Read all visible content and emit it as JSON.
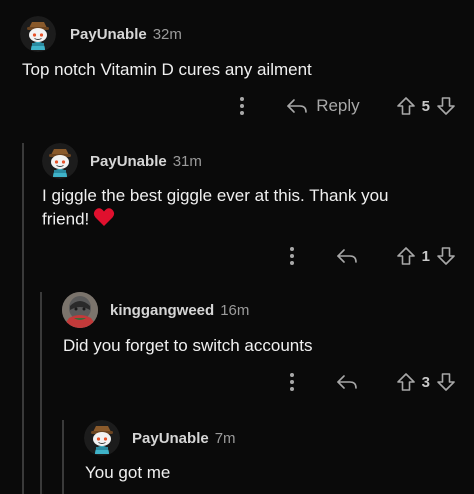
{
  "comments": [
    {
      "username": "PayUnable",
      "time": "32m",
      "text": "Top notch Vitamin D cures any ailment",
      "reply_label": "Reply",
      "votes": "5"
    },
    {
      "username": "PayUnable",
      "time": "31m",
      "text_line1": "I giggle the best giggle ever at this. Thank you",
      "text_line2": "friend!",
      "votes": "1"
    },
    {
      "username": "kinggangweed",
      "time": "16m",
      "text": "Did you forget to switch accounts",
      "votes": "3"
    },
    {
      "username": "PayUnable",
      "time": "7m",
      "text": "You got me"
    }
  ],
  "colors": {
    "heart": "#e0102e",
    "background": "#0a0a0a",
    "thread_line": "#3a3a3a"
  },
  "icons": [
    "snoo-avatar-icon",
    "more-options-icon",
    "reply-arrow-icon",
    "upvote-icon",
    "downvote-icon",
    "heart-emoji-icon"
  ]
}
